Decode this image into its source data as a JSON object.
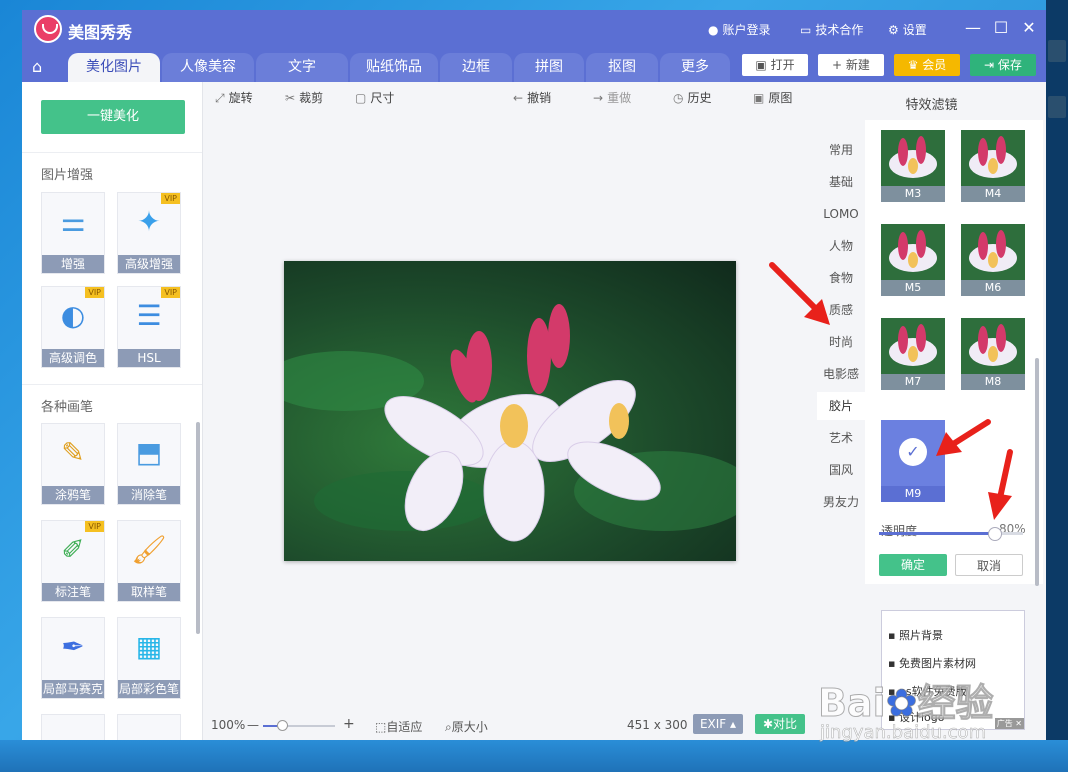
{
  "app": {
    "title": "美图秀秀"
  },
  "titlebar": {
    "login": "账户登录",
    "tech": "技术合作",
    "settings": "设置"
  },
  "tabs": [
    "美化图片",
    "人像美容",
    "文字",
    "贴纸饰品",
    "边框",
    "拼图",
    "抠图",
    "更多"
  ],
  "top_buttons": {
    "open": "打开",
    "new": "新建",
    "vip": "会员",
    "save": "保存"
  },
  "left": {
    "one_click": "一键美化",
    "section_enhance": "图片增强",
    "enhance_tools": [
      {
        "label": "增强",
        "icon": "sliders-icon",
        "vip": false
      },
      {
        "label": "高级增强",
        "icon": "magic-star-icon",
        "vip": true
      },
      {
        "label": "高级调色",
        "icon": "palette-icon",
        "vip": true
      },
      {
        "label": "HSL",
        "icon": "hsl-sliders-icon",
        "vip": true
      }
    ],
    "section_brush": "各种画笔",
    "brush_tools": [
      {
        "label": "涂鸦笔",
        "icon": "brush-icon",
        "vip": false
      },
      {
        "label": "消除笔",
        "icon": "eraser-icon",
        "vip": false
      },
      {
        "label": "标注笔",
        "icon": "marker-icon",
        "vip": true
      },
      {
        "label": "取样笔",
        "icon": "sample-brush-icon",
        "vip": false
      },
      {
        "label": "局部马赛克",
        "icon": "mosaic-pen-icon",
        "vip": false
      },
      {
        "label": "局部彩色笔",
        "icon": "color-pen-icon",
        "vip": false
      }
    ],
    "vip_badge": "VIP"
  },
  "toolbar": {
    "rotate": "旋转",
    "crop": "裁剪",
    "size": "尺寸",
    "undo": "撤销",
    "redo": "重做",
    "history": "历史",
    "original": "原图"
  },
  "bottom": {
    "zoom": "100%",
    "zoom_minus": "—",
    "zoom_plus": "+",
    "fit": "自适应",
    "actual": "原大小",
    "dimensions": "451 x 300",
    "exif": "EXIF",
    "compare": "对比"
  },
  "filters": {
    "title": "特效滤镜",
    "categories": [
      "常用",
      "基础",
      "LOMO",
      "人物",
      "食物",
      "质感",
      "时尚",
      "电影感",
      "胶片",
      "艺术",
      "国风",
      "男友力"
    ],
    "selected_category": "胶片",
    "items": [
      "M3",
      "M4",
      "M5",
      "M6",
      "M7",
      "M8",
      "M9"
    ],
    "selected_item": "M9",
    "opacity_label": "透明度",
    "opacity_value": "80%",
    "opacity": 0.8,
    "confirm": "确定",
    "cancel": "取消"
  },
  "ad": {
    "items": [
      "照片背景",
      "免费图片素材网",
      "ps软件免费版",
      "设计logo"
    ],
    "tag": "广告"
  },
  "watermark": {
    "brand": "Bai",
    "brand2": "经验",
    "url": "jingyan.baidu.com"
  },
  "colors": {
    "title_bar": "#5b6fd3",
    "accent_green": "#44c28a",
    "vip_gold": "#f5b800",
    "arrow_red": "#e8211b"
  }
}
